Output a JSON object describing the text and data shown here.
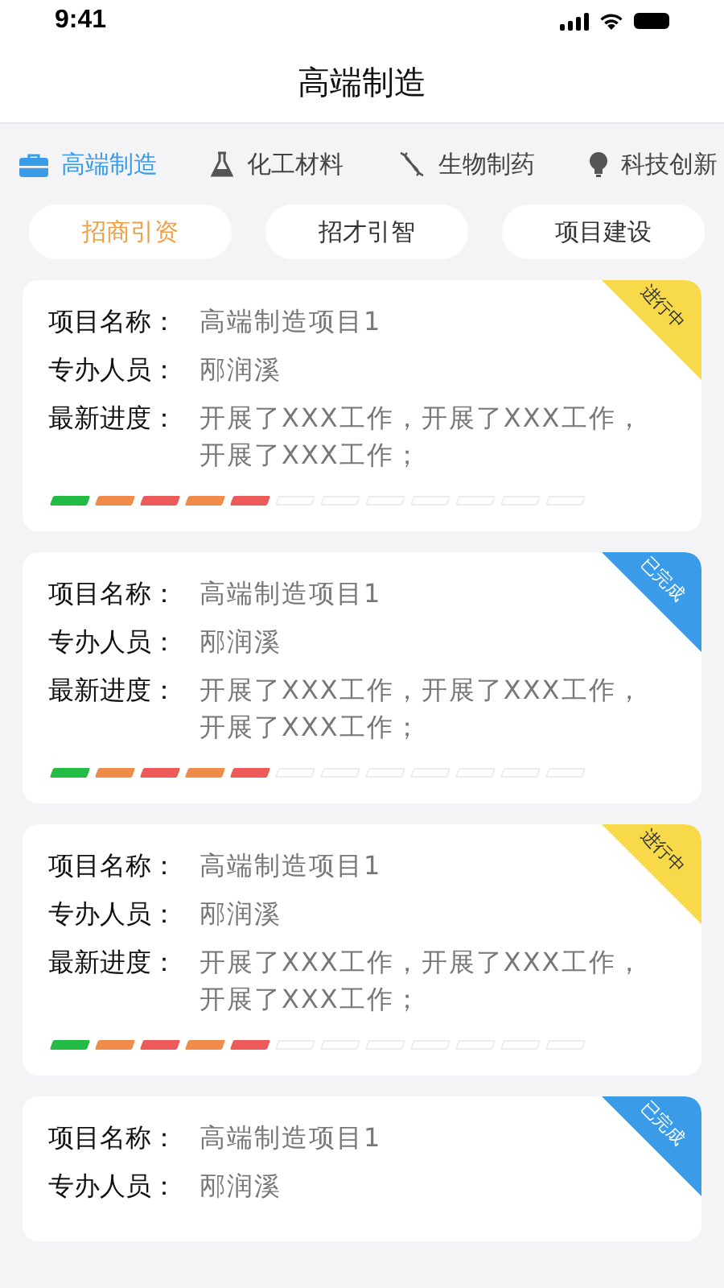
{
  "status_bar": {
    "time": "9:41"
  },
  "title": "高端制造",
  "categories": [
    {
      "label": "高端制造",
      "selected": true
    },
    {
      "label": "化工材料",
      "selected": false
    },
    {
      "label": "生物制药",
      "selected": false
    },
    {
      "label": "科技创新",
      "selected": false
    }
  ],
  "filters": [
    {
      "label": "招商引资",
      "selected": true
    },
    {
      "label": "招才引智",
      "selected": false
    },
    {
      "label": "项目建设",
      "selected": false
    }
  ],
  "projects": [
    {
      "status": {
        "kind": "ongoing",
        "label": "进行中"
      },
      "fields": [
        {
          "label": "项目名称：",
          "value": "高端制造项目1"
        },
        {
          "label": "专办人员：",
          "value": "邴润溪"
        },
        {
          "label": "最新进度：",
          "value": "开展了XXX工作，开展了XXX工作，开展了XXX工作；"
        }
      ],
      "segments": [
        {
          "filled": true,
          "color": "#22bb44"
        },
        {
          "filled": true,
          "color": "#f08c4a"
        },
        {
          "filled": true,
          "color": "#ec5a5a"
        },
        {
          "filled": true,
          "color": "#f08c4a"
        },
        {
          "filled": true,
          "color": "#ec5a5a"
        },
        {
          "filled": false
        },
        {
          "filled": false
        },
        {
          "filled": false
        },
        {
          "filled": false
        },
        {
          "filled": false
        },
        {
          "filled": false
        },
        {
          "filled": false
        }
      ]
    },
    {
      "status": {
        "kind": "done",
        "label": "已完成"
      },
      "fields": [
        {
          "label": "项目名称：",
          "value": "高端制造项目1"
        },
        {
          "label": "专办人员：",
          "value": "邴润溪"
        },
        {
          "label": "最新进度：",
          "value": "开展了XXX工作，开展了XXX工作，开展了XXX工作；"
        }
      ],
      "segments": [
        {
          "filled": true,
          "color": "#22bb44"
        },
        {
          "filled": true,
          "color": "#f08c4a"
        },
        {
          "filled": true,
          "color": "#ec5a5a"
        },
        {
          "filled": true,
          "color": "#f08c4a"
        },
        {
          "filled": true,
          "color": "#ec5a5a"
        },
        {
          "filled": false
        },
        {
          "filled": false
        },
        {
          "filled": false
        },
        {
          "filled": false
        },
        {
          "filled": false
        },
        {
          "filled": false
        },
        {
          "filled": false
        }
      ]
    },
    {
      "status": {
        "kind": "ongoing",
        "label": "进行中"
      },
      "fields": [
        {
          "label": "项目名称：",
          "value": "高端制造项目1"
        },
        {
          "label": "专办人员：",
          "value": "邴润溪"
        },
        {
          "label": "最新进度：",
          "value": "开展了XXX工作，开展了XXX工作，开展了XXX工作；"
        }
      ],
      "segments": [
        {
          "filled": true,
          "color": "#22bb44"
        },
        {
          "filled": true,
          "color": "#f08c4a"
        },
        {
          "filled": true,
          "color": "#ec5a5a"
        },
        {
          "filled": true,
          "color": "#f08c4a"
        },
        {
          "filled": true,
          "color": "#ec5a5a"
        },
        {
          "filled": false
        },
        {
          "filled": false
        },
        {
          "filled": false
        },
        {
          "filled": false
        },
        {
          "filled": false
        },
        {
          "filled": false
        },
        {
          "filled": false
        }
      ]
    },
    {
      "status": {
        "kind": "done",
        "label": "已完成"
      },
      "fields": [
        {
          "label": "项目名称：",
          "value": "高端制造项目1"
        },
        {
          "label": "专办人员：",
          "value": "邴润溪"
        }
      ]
    }
  ]
}
